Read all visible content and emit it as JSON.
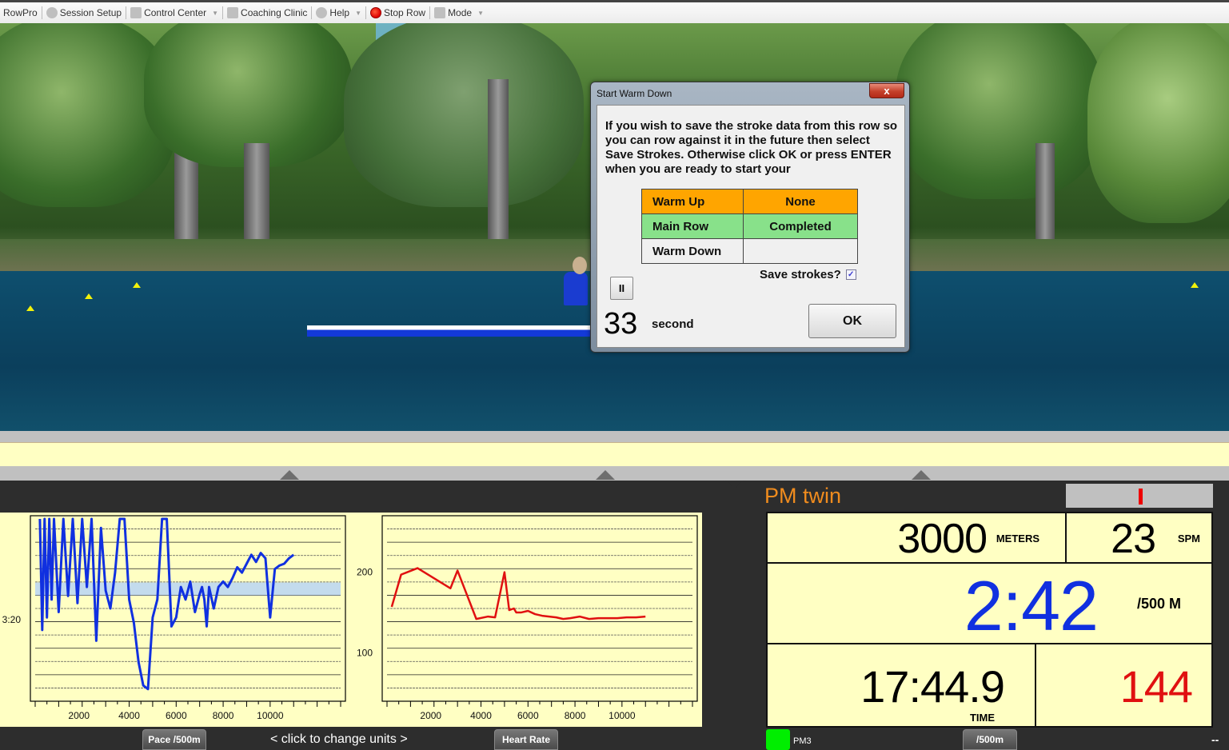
{
  "toolbar": {
    "app_name": "RowPro",
    "items": [
      {
        "label": "Session Setup",
        "icon": "gear-icon",
        "has_dropdown": false
      },
      {
        "label": "Control Center",
        "icon": "monitor-icon",
        "has_dropdown": true
      },
      {
        "label": "Coaching Clinic",
        "icon": "clinic-icon",
        "has_dropdown": false
      },
      {
        "label": "Help",
        "icon": "help-icon",
        "has_dropdown": true
      },
      {
        "label": "Stop Row",
        "icon": "stop-icon",
        "has_dropdown": false
      },
      {
        "label": "Mode",
        "icon": "user-icon",
        "has_dropdown": true
      }
    ]
  },
  "dialog": {
    "title": "Start Warm Down",
    "close_label": "x",
    "message": "If you wish to save the stroke data from this row so you can row against it in the future then select Save Strokes.  Otherwise click OK or press ENTER when you are ready to start your",
    "phases": [
      {
        "name": "Warm Up",
        "status": "None",
        "color": "#ffa500"
      },
      {
        "name": "Main Row",
        "status": "Completed",
        "color": "#88e18a"
      },
      {
        "name": "Warm Down",
        "status": "",
        "color": "#f0f0f0"
      }
    ],
    "save_strokes_label": "Save strokes?",
    "save_strokes_checked": true,
    "pause_label": "II",
    "countdown_value": "33",
    "countdown_unit": "second",
    "ok_label": "OK"
  },
  "graphs": {
    "left_button": "Pace /500m",
    "units_hint": "<  click to change units  >",
    "right_button": "Heart Rate"
  },
  "chart_data": [
    {
      "type": "line",
      "title": "Pace /500m",
      "xlabel": "",
      "ylabel": "",
      "x_tick_labels": [
        "2000",
        "4000",
        "6000",
        "8000",
        "10000"
      ],
      "y_tick_labels": [
        "3:20"
      ],
      "target_band": "pace target zone",
      "color": "#1030e0",
      "x": [
        200,
        300,
        400,
        500,
        600,
        700,
        800,
        1000,
        1200,
        1400,
        1600,
        1800,
        2000,
        2200,
        2400,
        2600,
        2800,
        3000,
        3200,
        3400,
        3600,
        3800,
        4000,
        4200,
        4400,
        4600,
        4800,
        5000,
        5200,
        5400,
        5600,
        5800,
        6000,
        6200,
        6400,
        6600,
        6800,
        7000,
        7100,
        7200,
        7300,
        7400,
        7600,
        7800,
        8000,
        8200,
        8400,
        8600,
        8800,
        9000,
        9200,
        9400,
        9600,
        9800,
        10000,
        10200,
        10400,
        10600,
        10800,
        11000
      ],
      "y_rel": [
        0.0,
        0.62,
        0.0,
        0.55,
        0.0,
        0.45,
        0.0,
        0.52,
        0.0,
        0.43,
        0.0,
        0.47,
        0.0,
        0.38,
        0.0,
        0.68,
        0.05,
        0.4,
        0.5,
        0.3,
        0.0,
        0.0,
        0.45,
        0.58,
        0.8,
        0.93,
        0.95,
        0.55,
        0.45,
        0.0,
        0.0,
        0.6,
        0.55,
        0.38,
        0.45,
        0.35,
        0.52,
        0.42,
        0.38,
        0.45,
        0.6,
        0.38,
        0.5,
        0.38,
        0.35,
        0.38,
        0.33,
        0.27,
        0.3,
        0.25,
        0.2,
        0.24,
        0.19,
        0.22,
        0.55,
        0.28,
        0.26,
        0.25,
        0.22,
        0.2
      ],
      "x_range": [
        0,
        13000
      ]
    },
    {
      "type": "line",
      "title": "Heart Rate",
      "xlabel": "",
      "ylabel": "",
      "x_tick_labels": [
        "2000",
        "4000",
        "6000",
        "8000",
        "10000"
      ],
      "y_tick_labels": [
        "100",
        "200"
      ],
      "ylim": [
        40,
        270
      ],
      "x_range": [
        0,
        13000
      ],
      "color": "#e01010",
      "x": [
        200,
        600,
        1300,
        2700,
        3000,
        3800,
        4300,
        4600,
        5000,
        5200,
        5400,
        5500,
        5700,
        6000,
        6300,
        6600,
        6900,
        7200,
        7500,
        7800,
        8200,
        8600,
        9000,
        9400,
        9800,
        10200,
        10600,
        11000
      ],
      "values": [
        157,
        197,
        205,
        180,
        202,
        142,
        145,
        144,
        200,
        153,
        155,
        150,
        150,
        152,
        148,
        146,
        145,
        144,
        142,
        143,
        145,
        142,
        143,
        143,
        143,
        144,
        144,
        145
      ]
    }
  ],
  "pm": {
    "title": "PM twin",
    "distance": "3000",
    "distance_unit": "METERS",
    "spm": "23",
    "spm_unit": "SPM",
    "pace": "2:42",
    "pace_unit": "/500 M",
    "time": "17:44.9",
    "time_unit": "TIME",
    "heart_rate": "144",
    "monitor_label": "PM3",
    "units_button": "/500m",
    "right_indicator": "--"
  },
  "colors": {
    "panel_bg": "#2d2d2d",
    "display_bg": "#ffffc3",
    "pace_color": "#1030e0",
    "hr_color": "#e01010",
    "title_orange": "#f08c1e"
  }
}
